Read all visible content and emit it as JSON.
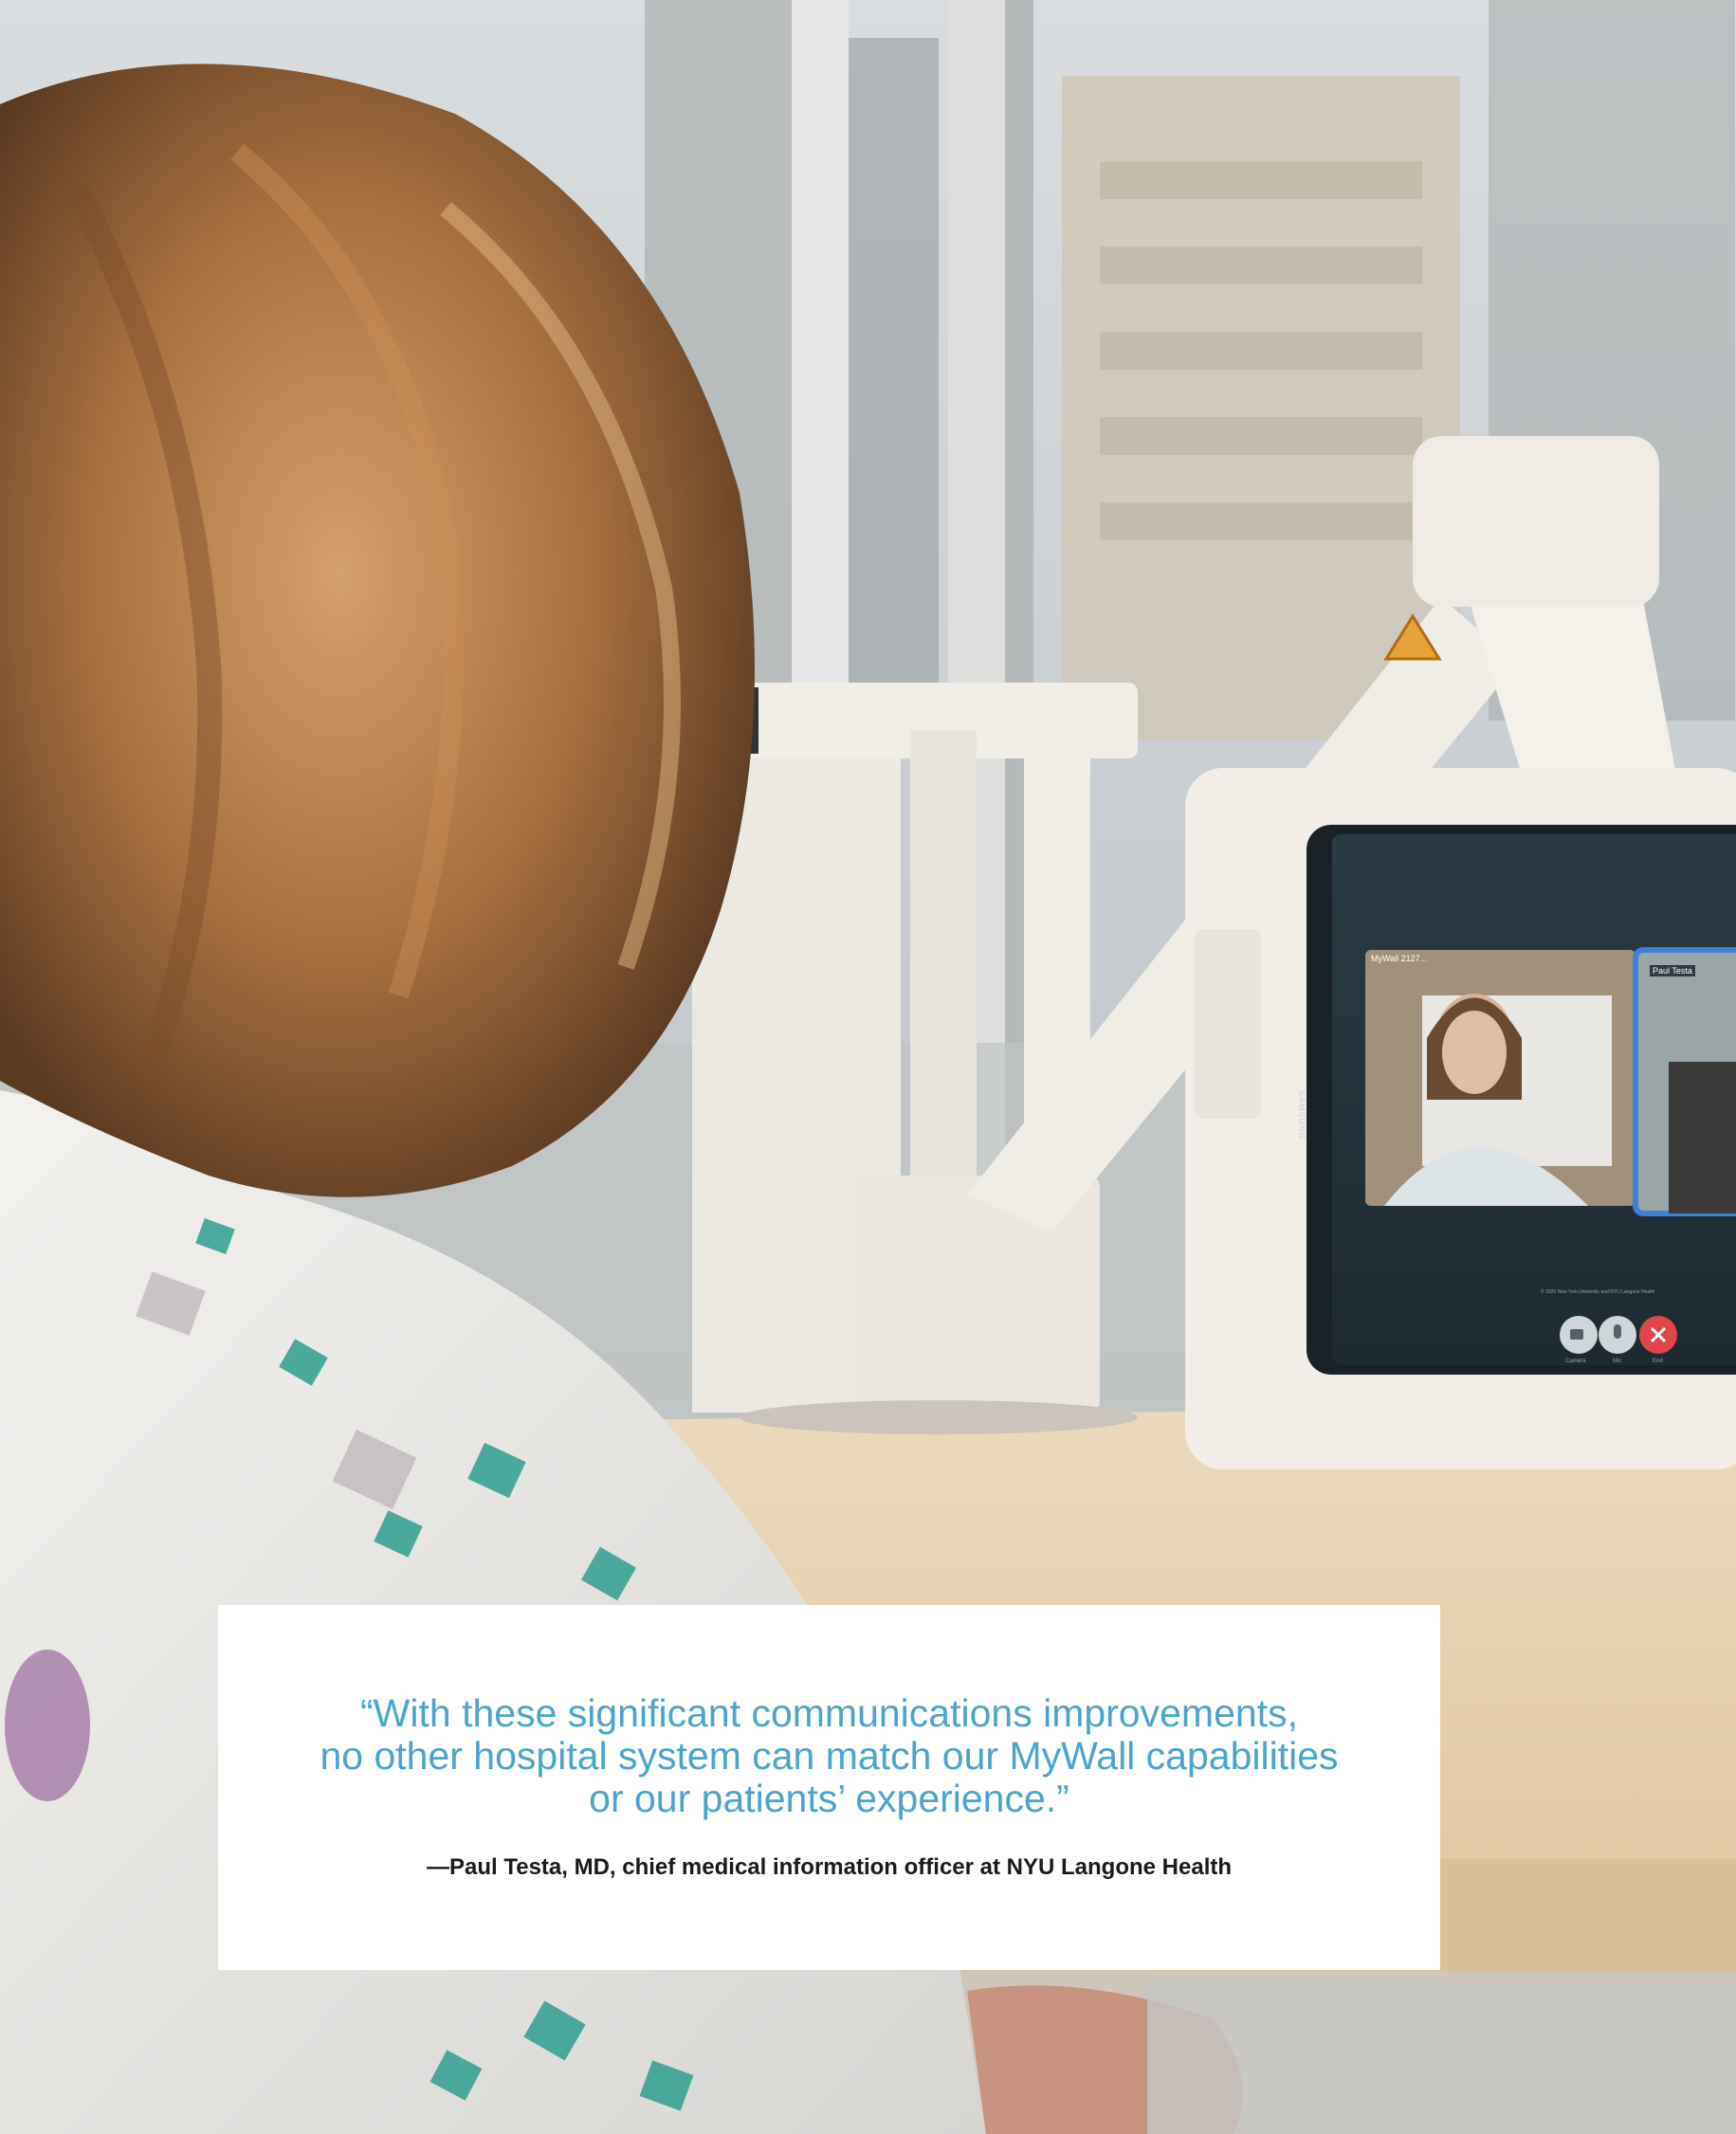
{
  "quote": {
    "lines": [
      "“With these significant communications improvements,",
      "no other hospital system can match our MyWall capabilities",
      "or our patients’ experience.”"
    ],
    "attribution": "—Paul Testa, MD, chief medical information officer at NYU Langone Health"
  },
  "tablet": {
    "brand": "SAMSUNG",
    "tile_left_label": "MyWall 2127...",
    "tile_right_label": "Paul Testa",
    "footer": "© 2026 New York University and NYU Langone Health",
    "controls": {
      "camera": "Camera",
      "mic": "Mic",
      "end": "End"
    }
  },
  "colors": {
    "quote": "#4aa4cc",
    "attribution": "#1a1a1a",
    "end_call": "#e0454a",
    "tile_highlight": "#3b82d6"
  }
}
